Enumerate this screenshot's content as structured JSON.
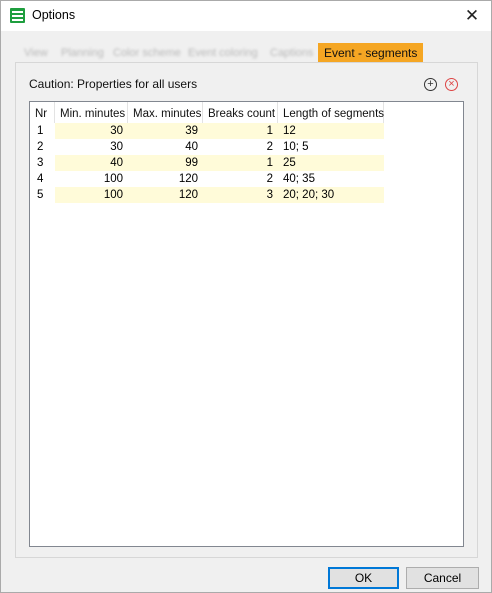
{
  "window": {
    "title": "Options"
  },
  "tabs": [
    {
      "label": "View"
    },
    {
      "label": "Planning"
    },
    {
      "label": "Color scheme"
    },
    {
      "label": "Event coloring"
    },
    {
      "label": "Captions"
    },
    {
      "label": "Event - segments",
      "active": true
    }
  ],
  "panel": {
    "caution": "Caution: Properties for all users"
  },
  "table": {
    "columns": [
      "Nr",
      "Min. minutes",
      "Max. minutes",
      "Breaks count",
      "Length of segments"
    ],
    "rows": [
      {
        "nr": "1",
        "min": "30",
        "max": "39",
        "breaks": "1",
        "len": "12"
      },
      {
        "nr": "2",
        "min": "30",
        "max": "40",
        "breaks": "2",
        "len": "10; 5"
      },
      {
        "nr": "3",
        "min": "40",
        "max": "99",
        "breaks": "1",
        "len": "25"
      },
      {
        "nr": "4",
        "min": "100",
        "max": "120",
        "breaks": "2",
        "len": "40; 35"
      },
      {
        "nr": "5",
        "min": "100",
        "max": "120",
        "breaks": "3",
        "len": "20; 20; 30"
      }
    ]
  },
  "buttons": {
    "ok": "OK",
    "cancel": "Cancel"
  },
  "icons": {
    "app": "table-icon",
    "add": "plus-circle-icon",
    "remove": "remove-circle-icon",
    "close": "close-icon"
  },
  "colors": {
    "active_tab": "#f5a623",
    "row_highlight": "#fffbd9",
    "default_button_border": "#0078d7"
  }
}
